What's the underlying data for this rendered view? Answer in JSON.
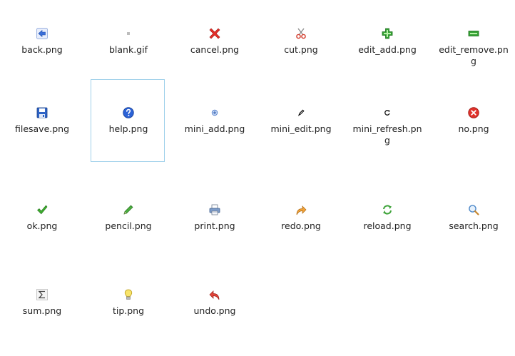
{
  "files": [
    {
      "name": "back.png",
      "icon": "back-arrow-icon"
    },
    {
      "name": "blank.gif",
      "icon": "blank-icon"
    },
    {
      "name": "cancel.png",
      "icon": "cancel-x-icon"
    },
    {
      "name": "cut.png",
      "icon": "scissors-icon"
    },
    {
      "name": "edit_add.png",
      "icon": "add-plus-icon"
    },
    {
      "name": "edit_remove.pn\ng",
      "icon": "remove-minus-icon"
    },
    {
      "name": "filesave.png",
      "icon": "floppy-save-icon"
    },
    {
      "name": "help.png",
      "icon": "help-question-icon"
    },
    {
      "name": "mini_add.png",
      "icon": "mini-add-icon"
    },
    {
      "name": "mini_edit.png",
      "icon": "mini-edit-icon"
    },
    {
      "name": "mini_refresh.pn\ng",
      "icon": "mini-refresh-icon"
    },
    {
      "name": "no.png",
      "icon": "no-stop-icon"
    },
    {
      "name": "ok.png",
      "icon": "checkmark-icon"
    },
    {
      "name": "pencil.png",
      "icon": "pencil-icon"
    },
    {
      "name": "print.png",
      "icon": "printer-icon"
    },
    {
      "name": "redo.png",
      "icon": "redo-arrow-icon"
    },
    {
      "name": "reload.png",
      "icon": "reload-arrows-icon"
    },
    {
      "name": "search.png",
      "icon": "magnifier-icon"
    },
    {
      "name": "sum.png",
      "icon": "sigma-sum-icon"
    },
    {
      "name": "tip.png",
      "icon": "lightbulb-tip-icon"
    },
    {
      "name": "undo.png",
      "icon": "undo-arrow-icon"
    }
  ],
  "selected": "help.png",
  "colors": {
    "selection_border": "#9fd0ea",
    "label_text": "#222222"
  }
}
